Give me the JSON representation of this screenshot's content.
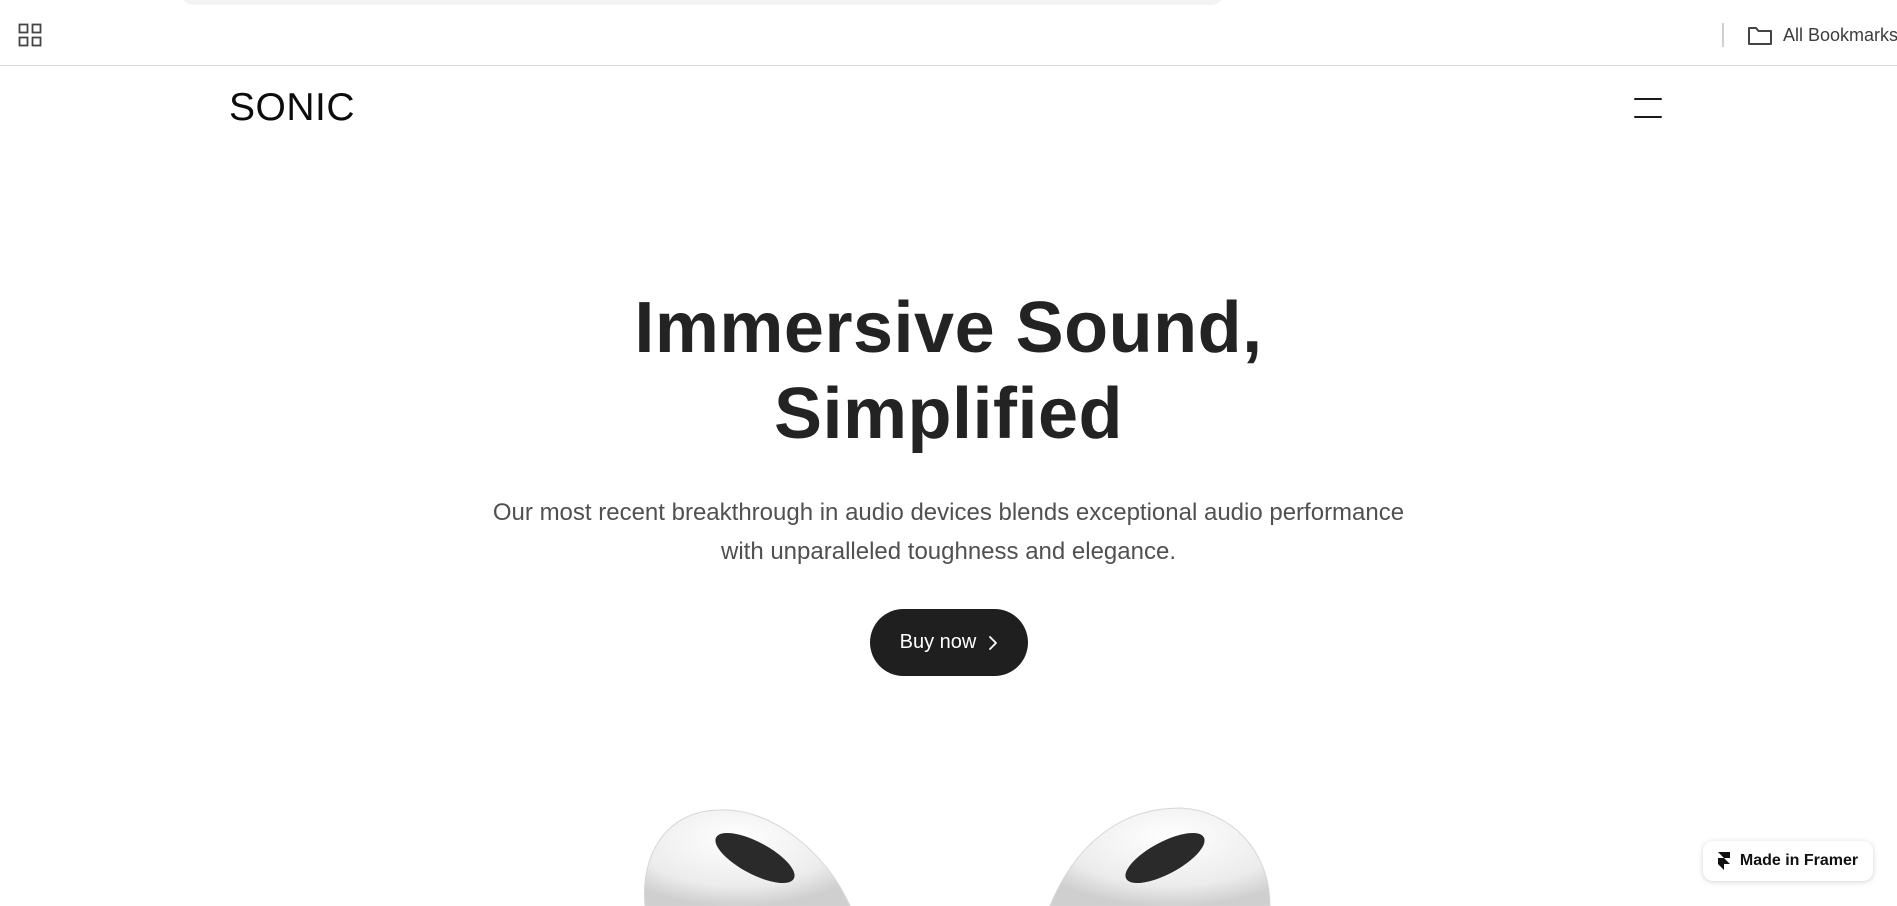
{
  "browser": {
    "bookmarks_bar": {
      "apps_icon": "apps-grid-icon",
      "all_bookmarks_label": "All Bookmarks",
      "all_bookmarks_icon": "folder-icon"
    }
  },
  "header": {
    "logo": "SONIC",
    "menu_icon": "hamburger-menu-icon"
  },
  "hero": {
    "title_line1": "Immersive Sound,",
    "title_line2": "Simplified",
    "subtitle_line1": "Our most recent breakthrough in audio devices blends exceptional audio performance",
    "subtitle_line2": "with unparalleled toughness and elegance.",
    "cta_label": "Buy now",
    "cta_icon": "chevron-right-icon"
  },
  "badge": {
    "label": "Made in Framer",
    "icon": "framer-logo-icon"
  },
  "colors": {
    "text_primary": "#232323",
    "text_secondary": "#505050",
    "button_bg": "#1f1f1f",
    "button_text": "#ffffff",
    "background": "#ffffff"
  }
}
